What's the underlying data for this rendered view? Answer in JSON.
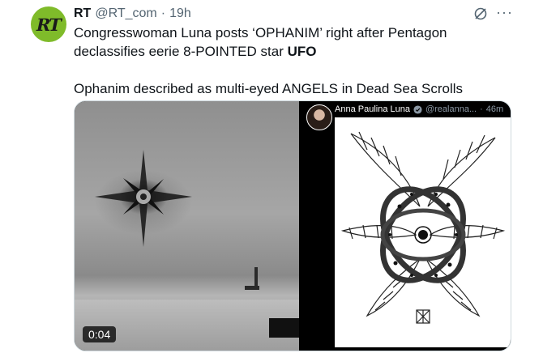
{
  "tweet": {
    "avatar_text": "RT",
    "name": "RT",
    "handle": "@RT_com",
    "separator": "·",
    "time": "19h",
    "more": "···",
    "text_line1_prefix": "Congresswoman Luna posts ‘OPHANIM’ right after Pentagon declassifies eerie 8-POINTED star ",
    "text_line1_bold": "UFO",
    "text_line2": "Ophanim described as multi-eyed ANGELS in Dead Sea Scrolls"
  },
  "media": {
    "duration": "0:04",
    "embed": {
      "name": "Anna Paulina Luna",
      "handle": "@realanna...",
      "separator": "·",
      "time": "46m"
    }
  },
  "icons": {
    "grok": "grok-icon",
    "more": "more-icon",
    "verified": "verified-badge-icon"
  },
  "colors": {
    "avatar_bg": "#7fbb2a",
    "muted": "#536471",
    "verified": "#1d9bf0"
  }
}
